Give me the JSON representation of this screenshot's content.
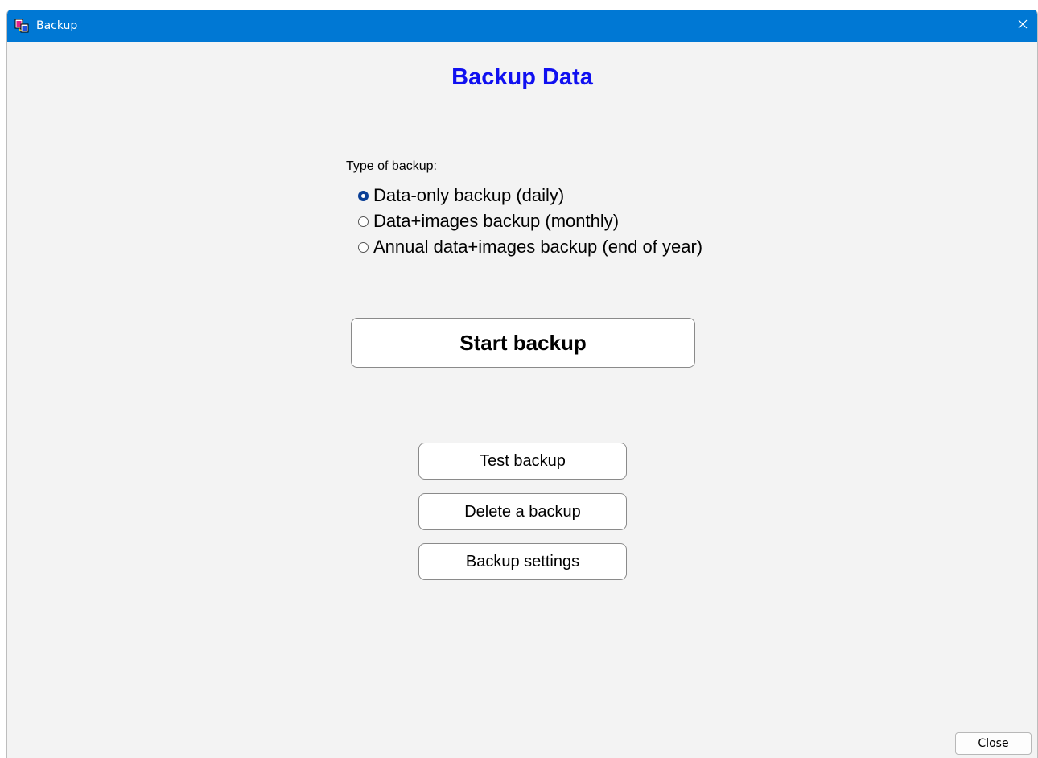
{
  "window": {
    "title": "Backup",
    "app_icon": "backup-app-icon",
    "close_icon": "close-icon",
    "titlebar_color": "#0078d4"
  },
  "header": {
    "title": "Backup Data",
    "title_color": "#1010f0"
  },
  "backup_type": {
    "label": "Type of backup:",
    "options": [
      {
        "label": "Data-only backup (daily)",
        "selected": true
      },
      {
        "label": "Data+images backup (monthly)",
        "selected": false
      },
      {
        "label": "Annual data+images backup (end of year)",
        "selected": false
      }
    ]
  },
  "actions": {
    "start_label": "Start backup",
    "test_label": "Test backup",
    "delete_label": "Delete a backup",
    "settings_label": "Backup settings"
  },
  "footer": {
    "close_label": "Close"
  }
}
